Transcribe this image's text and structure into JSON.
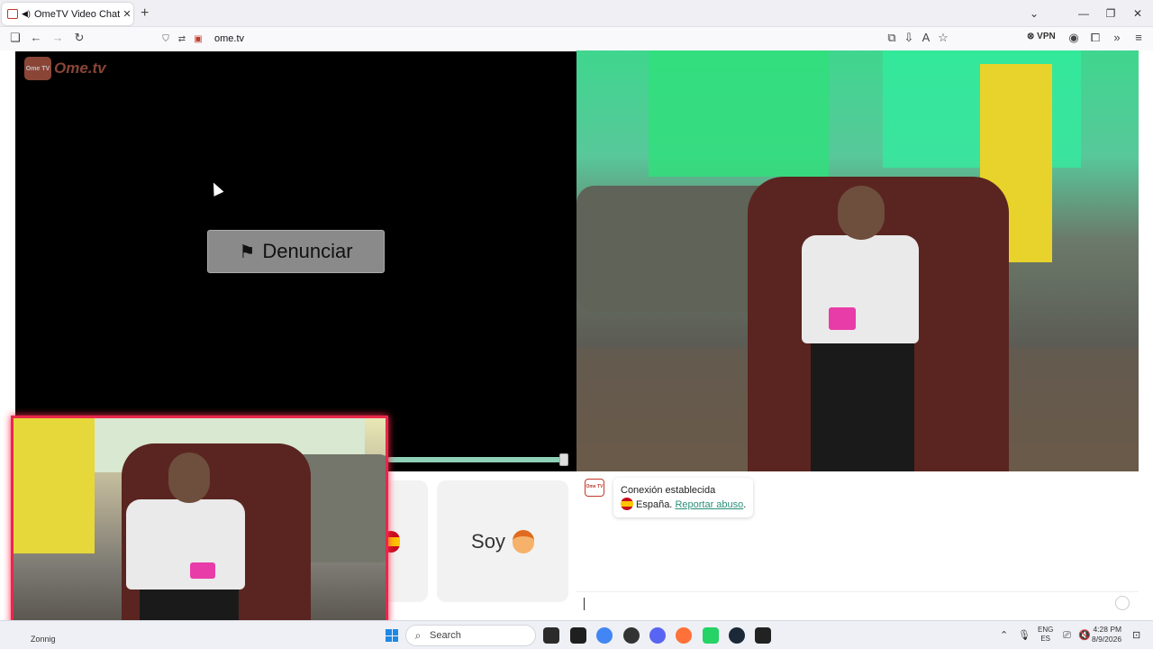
{
  "browser": {
    "tab_title": "OmeTV Video Chat — Omegle",
    "url": "ome.tv",
    "vpn_label": "VPN",
    "new_tab_label": "+",
    "tab_close": "✕",
    "minimize": "—",
    "restore": "❐",
    "close": "✕",
    "tab_list": "⌄"
  },
  "site": {
    "logo_text": "Ome.tv",
    "logo_badge": "Ome TV",
    "report_button": "Denunciar",
    "card_right_label": "Soy"
  },
  "chat": {
    "avatar_text": "Ome TV",
    "status_line": "Conexión establecida",
    "country": "España.",
    "report_link": "Reportar abuso",
    "report_link_suffix": ".",
    "input_value": ""
  },
  "taskbar": {
    "weather_text": "Zonnig",
    "search_placeholder": "Search",
    "lang_top": "ENG",
    "lang_bottom": "ES",
    "time": "4:28 PM",
    "date": "8/9/2026"
  },
  "colors": {
    "accent_red": "#e8284a",
    "progress": "#8fd0b8",
    "link": "#2a8f7a"
  }
}
